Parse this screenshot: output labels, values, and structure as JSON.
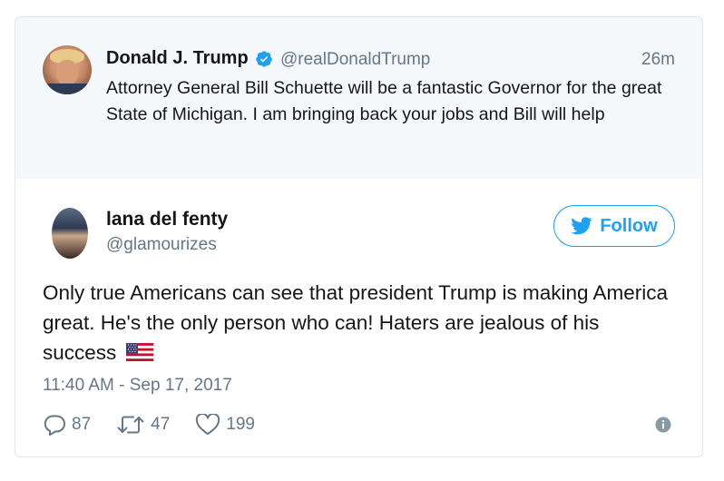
{
  "quoted_tweet": {
    "name": "Donald J. Trump",
    "handle": "@realDonaldTrump",
    "time": "26m",
    "text": "Attorney General Bill Schuette will be a fantastic Governor for the great State of Michigan. I am bringing back your jobs and Bill will help"
  },
  "main_tweet": {
    "name": "lana del fenty",
    "handle": "@glamourizes",
    "follow_label": "Follow",
    "text": "Only true Americans can see that president Trump is making America great. He's the only person who can! Haters are jealous of his success",
    "timestamp": "11:40 AM - Sep 17, 2017"
  },
  "actions": {
    "replies": "87",
    "retweets": "47",
    "likes": "199"
  },
  "colors": {
    "accent": "#1da1f2",
    "muted": "#657786",
    "text": "#14171a",
    "quoted_bg": "#f5f8fa"
  }
}
